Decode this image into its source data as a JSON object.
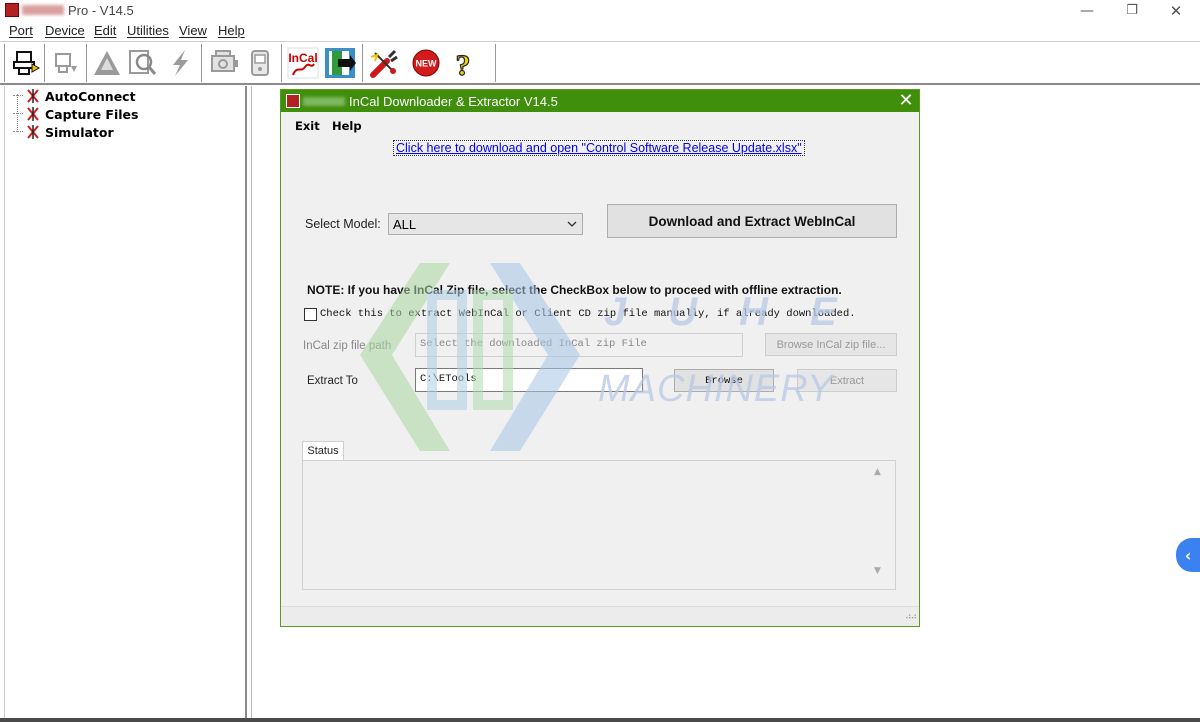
{
  "window": {
    "title": "Pro - V14.5",
    "controls": {
      "minimize": "—",
      "maximize": "❐",
      "close": "✕"
    }
  },
  "menu": {
    "port": "Port",
    "device": "Device",
    "edit": "Edit",
    "utilities": "Utilities",
    "view": "View",
    "help": "Help"
  },
  "toolbar": {
    "buttons": [
      {
        "icon": "connect-icon",
        "enabled": true
      },
      {
        "icon": "device-icon",
        "enabled": false
      },
      {
        "icon": "warning-triangle-icon",
        "enabled": false
      },
      {
        "icon": "inspect-icon",
        "enabled": false
      },
      {
        "icon": "lightning-icon",
        "enabled": false
      },
      {
        "icon": "engine-icon",
        "enabled": false
      },
      {
        "icon": "handheld-icon",
        "enabled": false
      },
      {
        "icon": "incal-icon",
        "label": "InCal",
        "enabled": true
      },
      {
        "icon": "exit-door-icon",
        "enabled": true
      },
      {
        "icon": "tools-icon",
        "enabled": true
      },
      {
        "icon": "new-badge-icon",
        "label": "NEW",
        "enabled": true
      },
      {
        "icon": "help-question-icon",
        "label": "?",
        "enabled": true
      }
    ]
  },
  "tree": {
    "items": [
      {
        "label": "AutoConnect",
        "icon": "disconnected-icon"
      },
      {
        "label": "Capture Files",
        "icon": "disconnected-icon"
      },
      {
        "label": "Simulator",
        "icon": "disconnected-icon"
      }
    ]
  },
  "dialog": {
    "title": "InCal Downloader & Extractor V14.5",
    "close": "✕",
    "menu": {
      "exit": "Exit",
      "help": "Help"
    },
    "link": "Click here to download and open \"Control Software Release Update.xlsx\"",
    "select_model_label": "Select Model:",
    "select_model_value": "ALL",
    "download_button": "Download and Extract WebInCal",
    "note": "NOTE: If you have InCal Zip file, select the CheckBox below to proceed with offline extraction.",
    "offline_checkbox_label": "Check this to extract WebInCal or Client CD zip file manually, if already downloaded.",
    "offline_checked": false,
    "zip_path_label": "InCal zip file path",
    "zip_path_placeholder": "Select the downloaded InCal zip File",
    "browse_zip_button": "Browse InCal zip file...",
    "extract_to_label": "Extract To",
    "extract_to_value": "C:\\ETools",
    "browse_button": "Browse",
    "extract_button": "Extract",
    "status_tab": "Status",
    "status_text": ""
  },
  "watermark": {
    "letters": "JUHE",
    "subtitle": "MACHINERY"
  },
  "side_tab": {
    "icon": "chevron-left-icon",
    "glyph": "‹"
  },
  "colors": {
    "dialog_titlebar": "#3f8f0d",
    "link": "#0000ee",
    "side_tab": "#3b82f0"
  }
}
